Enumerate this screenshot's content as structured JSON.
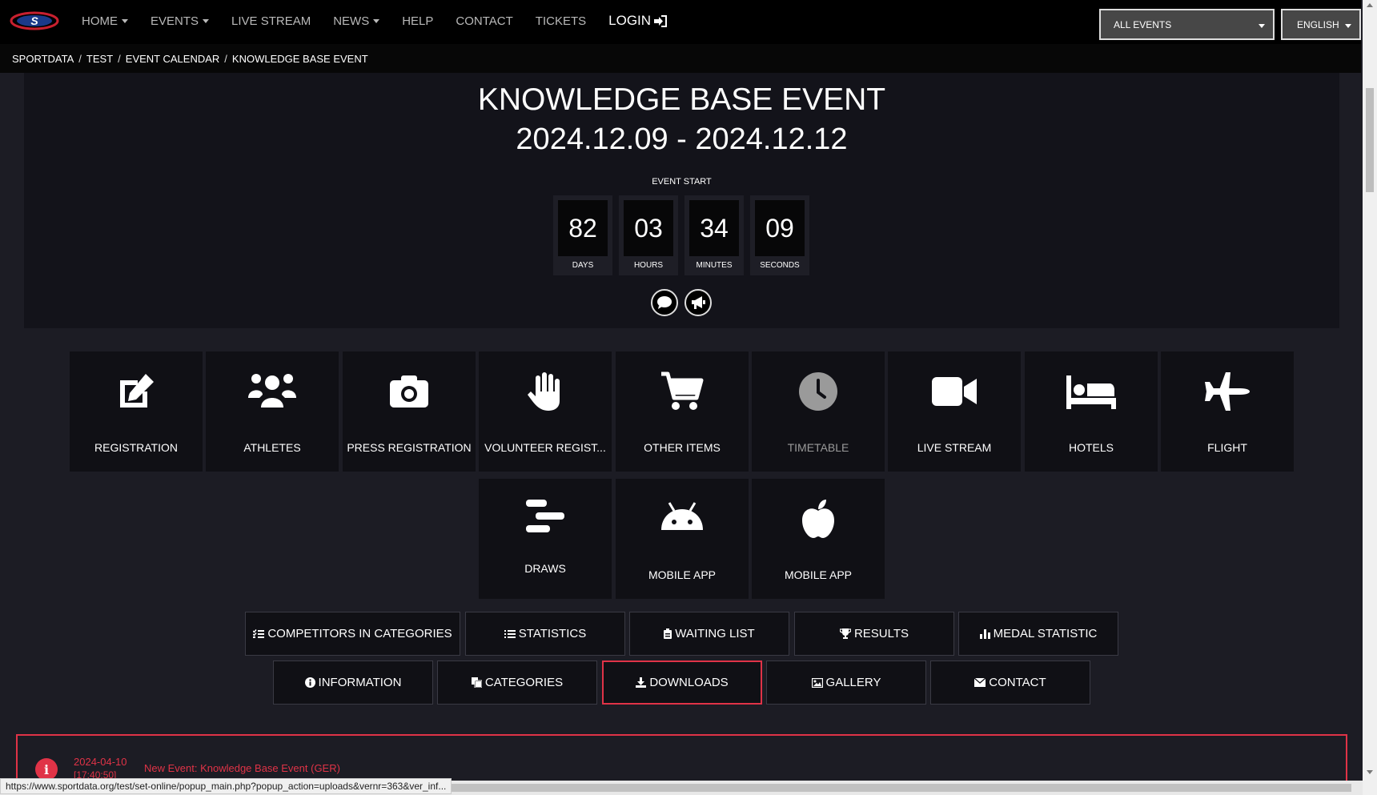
{
  "nav": {
    "logo_icon": "sportdata-logo",
    "items": [
      {
        "label": "HOME",
        "has_caret": true
      },
      {
        "label": "EVENTS",
        "has_caret": true
      },
      {
        "label": "LIVE STREAM",
        "has_caret": false
      },
      {
        "label": "NEWS",
        "has_caret": true
      },
      {
        "label": "HELP",
        "has_caret": false
      },
      {
        "label": "CONTACT",
        "has_caret": false
      },
      {
        "label": "TICKETS",
        "has_caret": false
      }
    ],
    "login_label": "LOGIN",
    "events_select": "ALL EVENTS",
    "language_select": "ENGLISH"
  },
  "breadcrumb": [
    "SPORTDATA",
    "TEST",
    "EVENT CALENDAR",
    "KNOWLEDGE BASE EVENT"
  ],
  "event": {
    "title": "KNOWLEDGE BASE EVENT",
    "dates": "2024.12.09 - 2024.12.12",
    "start_label": "EVENT START",
    "countdown": [
      {
        "value": "82",
        "label": "DAYS"
      },
      {
        "value": "03",
        "label": "HOURS"
      },
      {
        "value": "34",
        "label": "MINUTES"
      },
      {
        "value": "09",
        "label": "SECONDS"
      }
    ]
  },
  "tiles": [
    {
      "label": "REGISTRATION",
      "icon": "edit-icon"
    },
    {
      "label": "ATHLETES",
      "icon": "users-icon"
    },
    {
      "label": "PRESS REGISTRATION",
      "icon": "camera-icon"
    },
    {
      "label": "VOLUNTEER REGIST...",
      "icon": "hand-icon"
    },
    {
      "label": "OTHER ITEMS",
      "icon": "cart-icon"
    },
    {
      "label": "TIMETABLE",
      "icon": "clock-icon",
      "disabled": true
    },
    {
      "label": "LIVE STREAM",
      "icon": "video-icon"
    },
    {
      "label": "HOTELS",
      "icon": "bed-icon"
    },
    {
      "label": "FLIGHT",
      "icon": "plane-icon"
    },
    {
      "label": "DRAWS",
      "icon": "draws-icon"
    },
    {
      "label": "MOBILE APP",
      "icon": "android-icon"
    },
    {
      "label": "MOBILE APP",
      "icon": "apple-icon"
    }
  ],
  "buttons_row1": [
    {
      "label": "COMPETITORS IN CATEGORIES",
      "icon": "list-check-icon"
    },
    {
      "label": "STATISTICS",
      "icon": "list-icon"
    },
    {
      "label": "WAITING LIST",
      "icon": "clipboard-icon"
    },
    {
      "label": "RESULTS",
      "icon": "trophy-icon"
    },
    {
      "label": "MEDAL STATISTIC",
      "icon": "bar-chart-icon"
    }
  ],
  "buttons_row2": [
    {
      "label": "INFORMATION",
      "icon": "info-icon"
    },
    {
      "label": "CATEGORIES",
      "icon": "copy-icon"
    },
    {
      "label": "DOWNLOADS",
      "icon": "download-icon",
      "active": true
    },
    {
      "label": "GALLERY",
      "icon": "image-icon"
    },
    {
      "label": "CONTACT",
      "icon": "envelope-icon"
    }
  ],
  "news": {
    "date": "2024-04-10",
    "time": "[17:40:50]",
    "text": "New Event: Knowledge Base Event (GER)"
  },
  "status_url": "https://www.sportdata.org/test/set-online/popup_main.php?popup_action=uploads&vernr=363&ver_inf...",
  "colors": {
    "accent": "#e03347",
    "background": "#1c1c24",
    "tile": "#101015"
  }
}
